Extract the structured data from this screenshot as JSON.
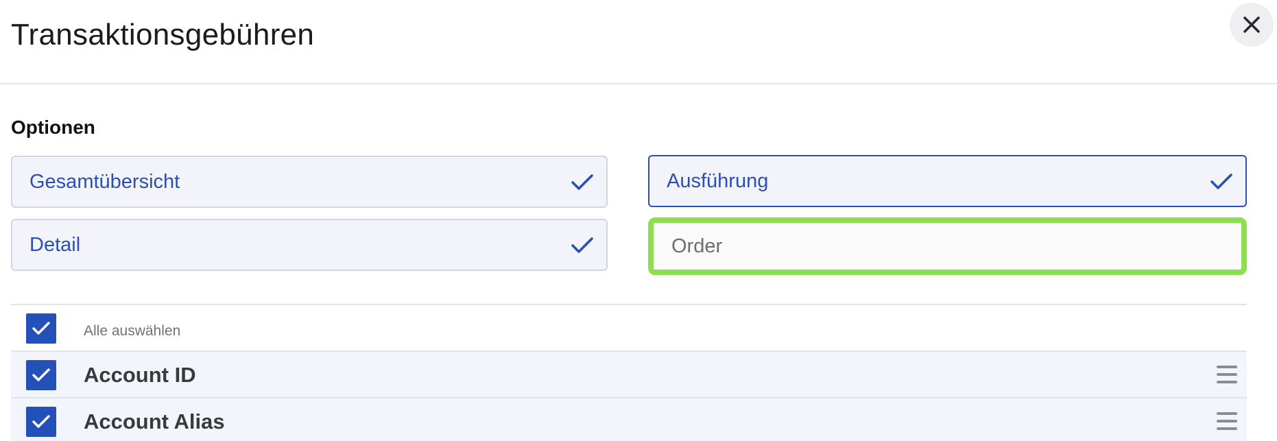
{
  "dialog": {
    "title": "Transaktionsgebühren"
  },
  "options": {
    "section_label": "Optionen",
    "items": [
      {
        "label": "Gesamtübersicht",
        "checked": true
      },
      {
        "label": "Ausführung",
        "checked": true
      },
      {
        "label": "Detail",
        "checked": true
      }
    ],
    "order_input": {
      "value": "",
      "placeholder": "Order"
    }
  },
  "list": {
    "select_all_label": "Alle auswählen",
    "select_all_checked": true,
    "rows": [
      {
        "label": "Account ID",
        "checked": true
      },
      {
        "label": "Account Alias",
        "checked": true
      }
    ]
  },
  "icons": {
    "close": "close-icon",
    "check": "check-icon",
    "drag": "drag-handle-icon"
  },
  "colors": {
    "accent_blue": "#2451b8",
    "option_text": "#2c4fb5",
    "highlight_green": "#8fde4f"
  }
}
